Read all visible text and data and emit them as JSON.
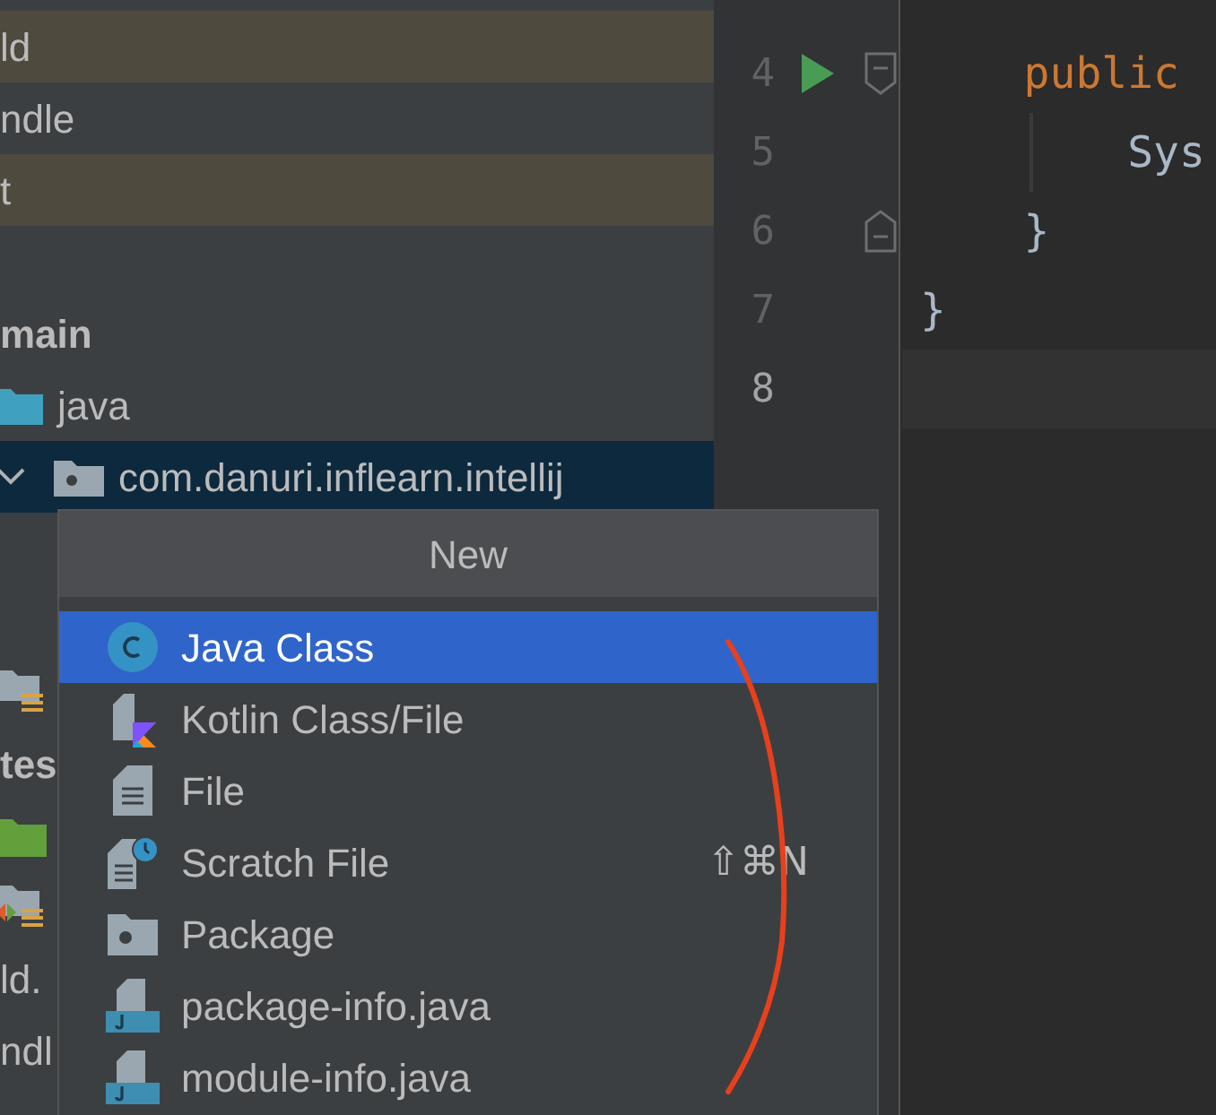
{
  "project_tree": {
    "rows": [
      {
        "kind": "file",
        "text": "ld",
        "highlighted": true,
        "selected": false
      },
      {
        "kind": "file",
        "text": "ndle",
        "highlighted": false,
        "selected": false
      },
      {
        "kind": "file",
        "text": "t",
        "highlighted": true,
        "selected": false
      },
      {
        "kind": "module",
        "text": "main",
        "selected": false
      },
      {
        "kind": "source_folder",
        "text": "java",
        "selected": false
      },
      {
        "kind": "package",
        "text": "com.danuri.inflearn.intellij",
        "expanded": true,
        "selected": true
      }
    ],
    "rows_below": [
      {
        "kind": "resources_folder",
        "selected": false
      },
      {
        "kind": "module",
        "text": "tes",
        "selected": false
      },
      {
        "kind": "test_folder",
        "selected": false
      },
      {
        "kind": "test_resources_folder",
        "selected": false
      },
      {
        "kind": "file",
        "text": "ld.",
        "highlighted": false,
        "selected": false
      },
      {
        "kind": "file",
        "text": "ndl",
        "highlighted": false,
        "selected": false
      }
    ]
  },
  "editor": {
    "lines": [
      {
        "number": "4",
        "run": true,
        "fold_open": true,
        "fold_close": false,
        "guide": false,
        "kind": "keyword",
        "text": "    public",
        "current": false
      },
      {
        "number": "5",
        "run": false,
        "fold_open": false,
        "fold_close": false,
        "guide": true,
        "kind": "plain",
        "text": "        Sys",
        "current": false
      },
      {
        "number": "6",
        "run": false,
        "fold_open": false,
        "fold_close": true,
        "guide": false,
        "kind": "plain",
        "text": "    }",
        "current": false
      },
      {
        "number": "7",
        "run": false,
        "fold_open": false,
        "fold_close": false,
        "guide": false,
        "kind": "plain",
        "text": "}",
        "current": false
      },
      {
        "number": "8",
        "run": false,
        "fold_open": false,
        "fold_close": false,
        "guide": false,
        "current": true
      }
    ]
  },
  "new_popup": {
    "title": "New",
    "items": [
      {
        "kind": "class",
        "label": "Java Class",
        "selected": true
      },
      {
        "kind": "kotlin",
        "label": "Kotlin Class/File",
        "selected": false
      },
      {
        "kind": "file",
        "label": "File",
        "selected": false
      },
      {
        "kind": "scratch",
        "label": "Scratch File",
        "shortcut": "⇧⌘N",
        "selected": false
      },
      {
        "kind": "package",
        "label": "Package",
        "selected": false
      },
      {
        "kind": "java_file",
        "label": "package-info.java",
        "selected": false
      },
      {
        "kind": "java_file",
        "label": "module-info.java",
        "selected": false
      }
    ]
  },
  "annotation": {
    "kind": "red_curve"
  }
}
